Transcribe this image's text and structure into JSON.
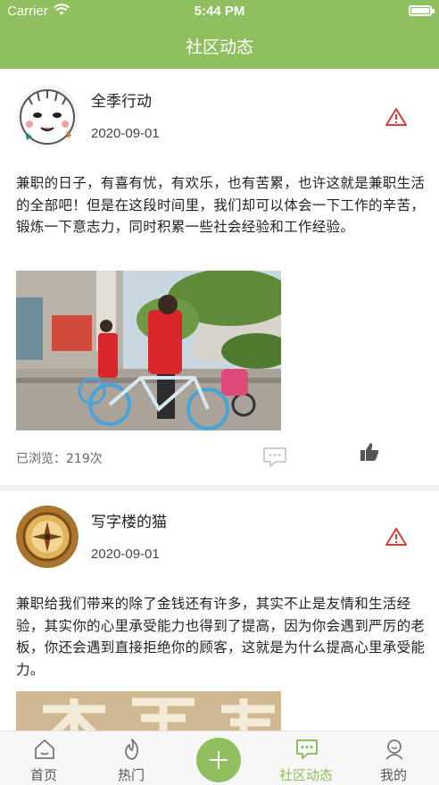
{
  "status_bar": {
    "carrier": "Carrier",
    "time": "5:44 PM"
  },
  "header": {
    "title": "社区动态"
  },
  "colors": {
    "brand": "#8fbf5e",
    "warning": "#e53935"
  },
  "posts": [
    {
      "username": "全季行动",
      "date": "2020-09-01",
      "content": "兼职的日子，有喜有忧，有欢乐，也有苦累，也许这就是兼职生活的全部吧！但是在这段时间里，我们却可以体会一下工作的辛苦，锻炼一下意志力，同时积累一些社会经验和工作经验。",
      "views": "已浏览：219次",
      "avatar_icon": "cartoon-face-avatar",
      "image": "volunteer-with-shared-bike-photo"
    },
    {
      "username": "写字楼的猫",
      "date": "2020-09-01",
      "content": "兼职给我们带来的除了金钱还有许多，其实不止是友情和生活经验，其实你的心里承受能力也得到了提高，因为你会遇到严厉的老板，你还会遇到直接拒绝你的顾客，这就是为什么提高心里承受能力。",
      "avatar_icon": "compass-avatar",
      "image": "college-student-banner-photo"
    }
  ],
  "tabs": [
    {
      "label": "首页",
      "icon": "home-icon"
    },
    {
      "label": "热门",
      "icon": "flame-icon"
    },
    {
      "label": "社区动态",
      "icon": "chat-icon",
      "active": true
    },
    {
      "label": "我的",
      "icon": "user-icon"
    }
  ],
  "add_button_icon": "plus-icon"
}
